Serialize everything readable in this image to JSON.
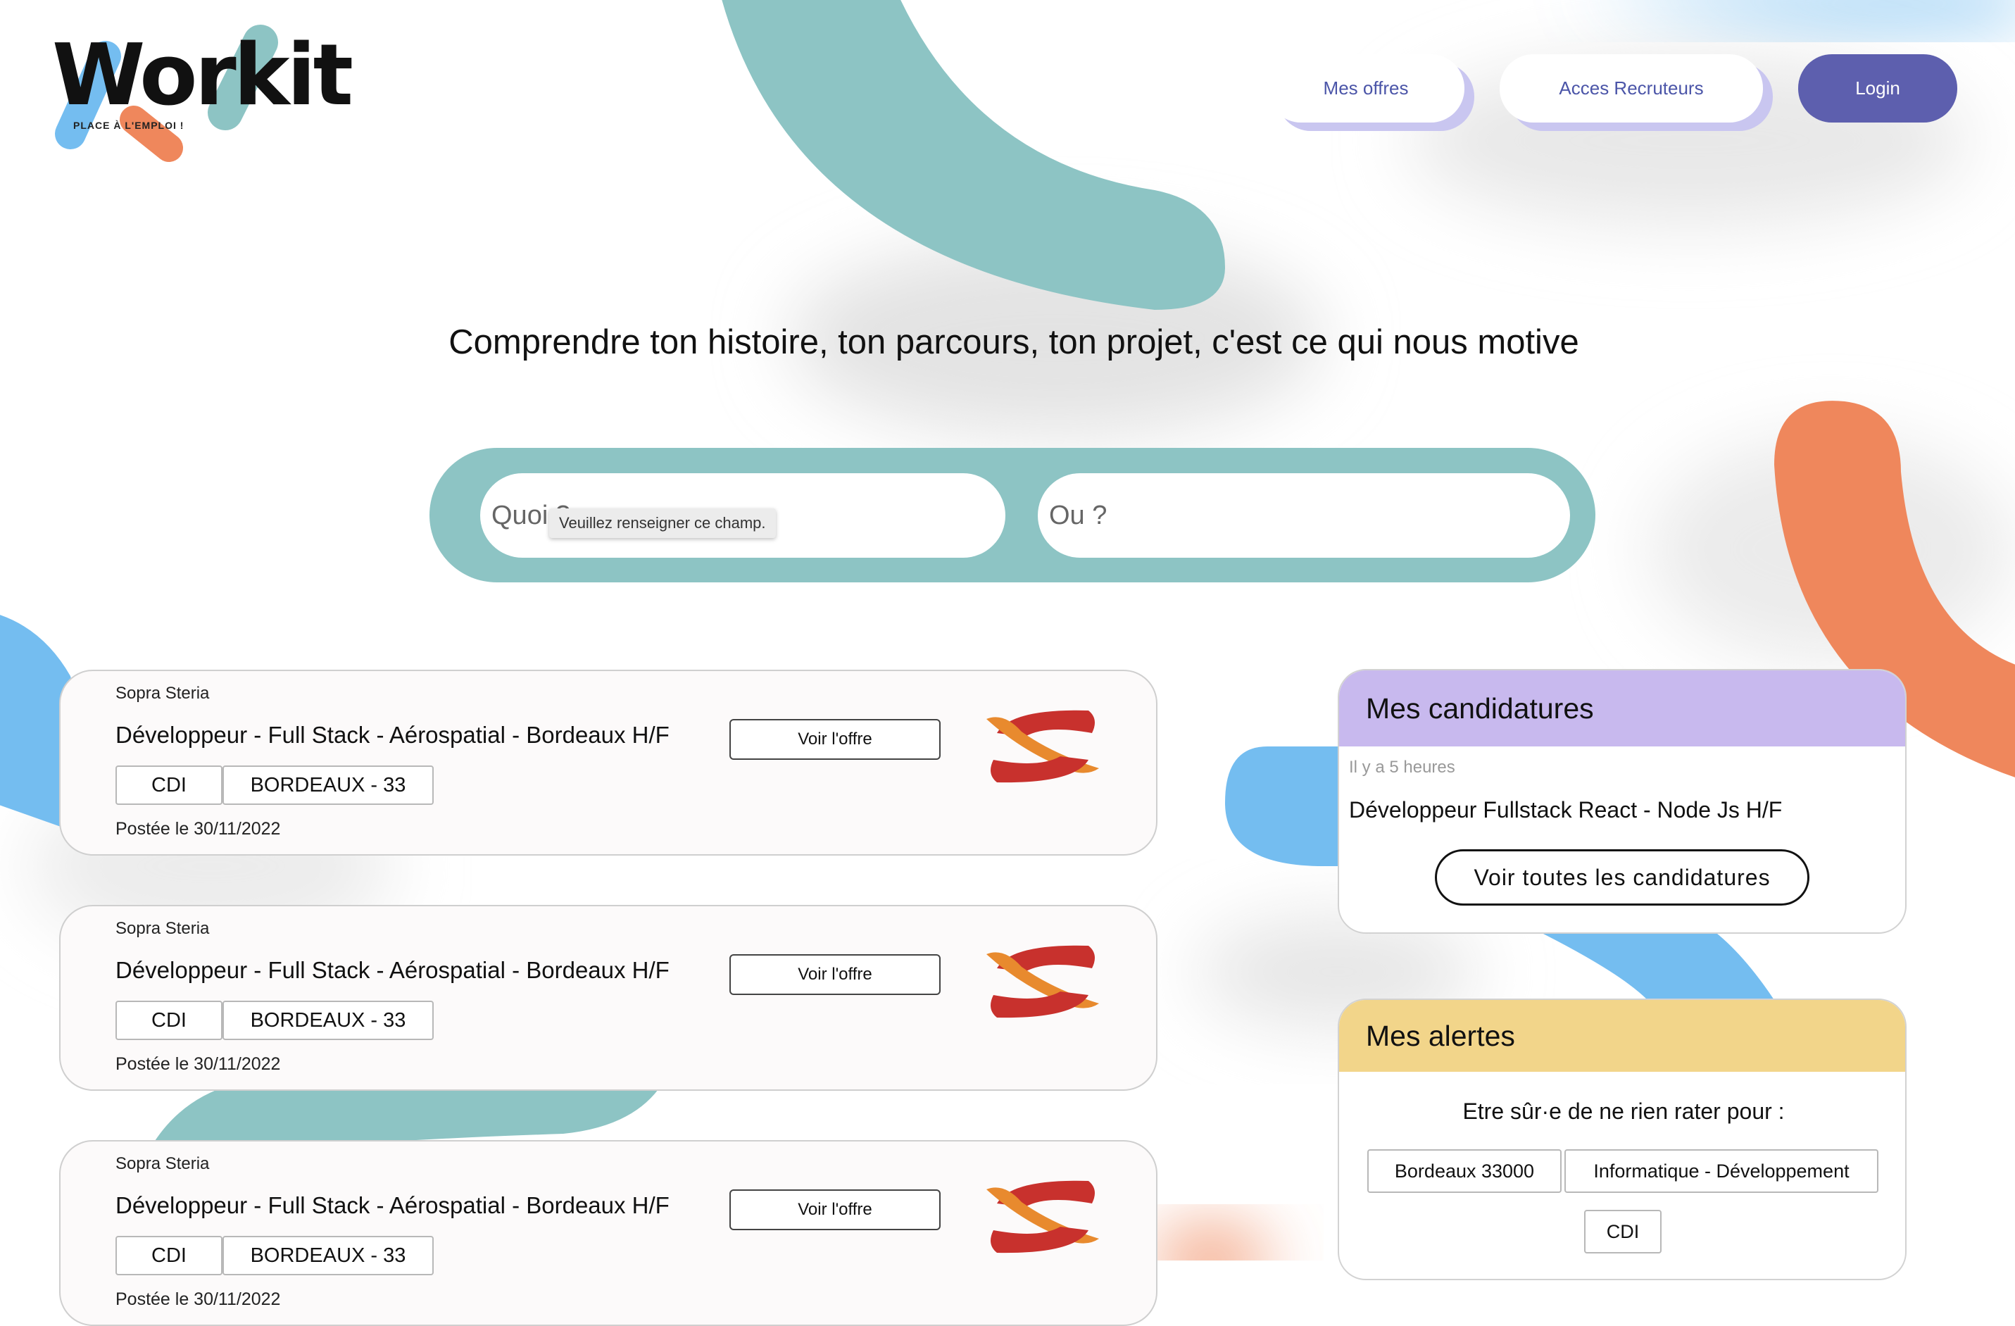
{
  "logo": {
    "word": "Workit",
    "tagline": "PLACE À L'EMPLOI !"
  },
  "nav": {
    "offres": "Mes offres",
    "recruteurs": "Acces Recruteurs",
    "login": "Login"
  },
  "headline": "Comprendre ton histoire, ton parcours, ton projet, c'est ce qui nous motive",
  "search": {
    "quoi_placeholder": "Quoi ?",
    "ou_placeholder": "Ou ?",
    "tooltip": "Veuillez renseigner ce champ."
  },
  "jobs": [
    {
      "company": "Sopra Steria",
      "title": "Développeur - Full Stack - Aérospatial - Bordeaux H/F",
      "type": "CDI",
      "location": "BORDEAUX - 33",
      "date": "Postée le 30/11/2022",
      "button": "Voir l'offre"
    },
    {
      "company": "Sopra Steria",
      "title": "Développeur - Full Stack - Aérospatial - Bordeaux H/F",
      "type": "CDI",
      "location": "BORDEAUX - 33",
      "date": "Postée le 30/11/2022",
      "button": "Voir l'offre"
    },
    {
      "company": "Sopra Steria",
      "title": "Développeur - Full Stack - Aérospatial - Bordeaux H/F",
      "type": "CDI",
      "location": "BORDEAUX - 33",
      "date": "Postée le 30/11/2022",
      "button": "Voir l'offre"
    }
  ],
  "candidatures": {
    "title": "Mes candidatures",
    "time": "Il y a 5 heures",
    "job": "Développeur Fullstack React - Node Js H/F",
    "button": "Voir toutes les candidatures"
  },
  "alertes": {
    "title": "Mes alertes",
    "text": "Etre sûr·e de ne rien rater pour :",
    "tags": [
      "Bordeaux 33000",
      "Informatique - Développement",
      "CDI"
    ]
  },
  "colors": {
    "teal": "#8dc4c4",
    "orange": "#ef875c",
    "blue": "#74bdf0",
    "purple": "#5d5fae",
    "lavender": "#c8b9ee",
    "yellow": "#f2d58a"
  }
}
